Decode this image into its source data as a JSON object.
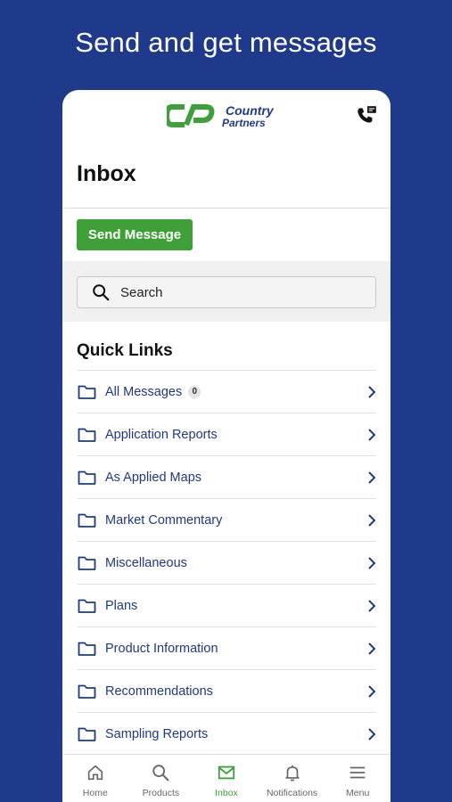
{
  "promo": {
    "title": "Send and get messages"
  },
  "header": {
    "logo_line1": "Country",
    "logo_line2": "Partners"
  },
  "inbox": {
    "title": "Inbox",
    "send_button": "Send Message"
  },
  "search": {
    "placeholder": "Search"
  },
  "quick_links": {
    "title": "Quick Links",
    "items": [
      {
        "label": "All Messages",
        "badge": "0"
      },
      {
        "label": "Application Reports"
      },
      {
        "label": "As Applied Maps"
      },
      {
        "label": "Market Commentary"
      },
      {
        "label": "Miscellaneous"
      },
      {
        "label": "Plans"
      },
      {
        "label": "Product Information"
      },
      {
        "label": "Recommendations"
      },
      {
        "label": "Sampling Reports"
      }
    ]
  },
  "tabs": [
    {
      "label": "Home",
      "icon": "home-icon"
    },
    {
      "label": "Products",
      "icon": "search-icon"
    },
    {
      "label": "Inbox",
      "icon": "mail-icon",
      "active": true
    },
    {
      "label": "Notifications",
      "icon": "bell-icon"
    },
    {
      "label": "Menu",
      "icon": "hamburger-icon"
    }
  ],
  "colors": {
    "background": "#1f3a8a",
    "accent_green": "#3fa03a",
    "link_blue": "#1f3a7a"
  }
}
